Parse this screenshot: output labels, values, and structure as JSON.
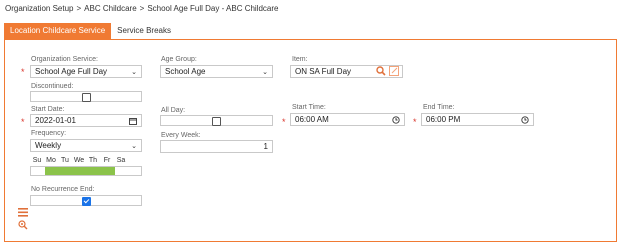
{
  "breadcrumb": {
    "items": [
      "Organization Setup",
      "ABC Childcare",
      "School Age Full Day - ABC Childcare"
    ],
    "separator": ">"
  },
  "tabs": [
    {
      "label": "Location Childcare Service",
      "active": true
    },
    {
      "label": "Service Breaks",
      "active": false
    }
  ],
  "form": {
    "org_service": {
      "label": "Organization Service:",
      "value": "School Age Full Day"
    },
    "age_group": {
      "label": "Age Group:",
      "value": "School Age"
    },
    "item": {
      "label": "Item:",
      "value": "ON SA Full Day"
    },
    "discontinued": {
      "label": "Discontinued:",
      "checked": false
    },
    "start_date": {
      "label": "Start Date:",
      "value": "2022-01-01"
    },
    "all_day": {
      "label": "All Day:",
      "checked": false
    },
    "start_time": {
      "label": "Start Time:",
      "value": "06:00 AM"
    },
    "end_time": {
      "label": "End Time:",
      "value": "06:00 PM"
    },
    "frequency": {
      "label": "Frequency:",
      "value": "Weekly"
    },
    "every_week": {
      "label": "Every Week:",
      "value": "1"
    },
    "days": {
      "labels": [
        "Su",
        "Mo",
        "Tu",
        "We",
        "Th",
        "Fr",
        "Sa"
      ],
      "selected": [
        false,
        true,
        true,
        true,
        true,
        true,
        false
      ]
    },
    "no_recurrence_end": {
      "label": "No Recurrence End:",
      "checked": true
    }
  },
  "colors": {
    "accent": "#f07a33",
    "required": "#d9342b",
    "day_on": "#8bc34a",
    "checked": "#1a73e8"
  }
}
